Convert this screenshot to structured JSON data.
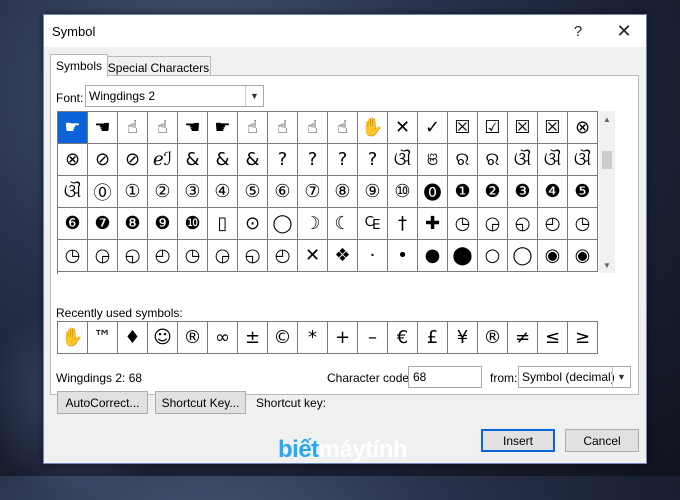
{
  "window": {
    "title": "Symbol",
    "help_label": "?",
    "close_label": "✕"
  },
  "tabs": [
    {
      "label": "Symbols"
    },
    {
      "label": "Special Characters"
    }
  ],
  "font": {
    "label": "Font:",
    "value": "Wingdings 2"
  },
  "symbol_grid": {
    "selected_index": 0,
    "rows": [
      [
        "☛",
        "☚",
        "☝",
        "☝",
        "☚",
        "☛",
        "☝",
        "☝",
        "☝",
        "☝",
        "✋",
        "✕",
        "✓",
        "☒",
        "☑",
        "☒",
        "☒",
        "⊗"
      ],
      [
        "⊗",
        "⊘",
        "⊘",
        "ℯℐ",
        "&",
        "&",
        "&",
        "?",
        "?",
        "?",
        "?",
        "ଔ",
        "ଞ",
        "ର",
        "ର",
        "ଔ",
        "ଔ",
        "ଔ"
      ],
      [
        "ଔ",
        "⓪",
        "①",
        "②",
        "③",
        "④",
        "⑤",
        "⑥",
        "⑦",
        "⑧",
        "⑨",
        "⑩",
        "⓿",
        "❶",
        "❷",
        "❸",
        "❹",
        "❺"
      ],
      [
        "❻",
        "❼",
        "❽",
        "❾",
        "❿",
        "▯",
        "⊙",
        "◯",
        "☽",
        "☾",
        "₠",
        "†",
        "✚",
        "◷",
        "◶",
        "◵",
        "◴",
        "◷"
      ],
      [
        "◷",
        "◶",
        "◵",
        "◴",
        "◷",
        "◶",
        "◵",
        "◴",
        "✕",
        "❖",
        "·",
        "•",
        "●",
        "⬤",
        "○",
        "◯",
        "◉",
        "◉"
      ]
    ]
  },
  "recently_used": {
    "label": "Recently used symbols:",
    "symbols": [
      "✋",
      "™",
      "♦",
      "☺",
      "®",
      "∞",
      "±",
      "©",
      "*",
      "+",
      "–",
      "€",
      "£",
      "¥",
      "®",
      "≠",
      "≤",
      "≥"
    ]
  },
  "footer": {
    "character_name": "Wingdings 2: 68",
    "code_label": "Character code:",
    "code_value": "68",
    "from_label": "from:",
    "from_value": "Symbol (decimal)",
    "autocorrect_label": "AutoCorrect...",
    "shortcut_label": "Shortcut Key...",
    "shortcut_key_label": "Shortcut key:"
  },
  "actions": {
    "insert_label": "Insert",
    "cancel_label": "Cancel"
  },
  "watermark": {
    "part1": "biết",
    "part2": "máytính"
  },
  "colors": {
    "selection": "#0a63d8",
    "watermark_accent": "#2aa8e8"
  }
}
